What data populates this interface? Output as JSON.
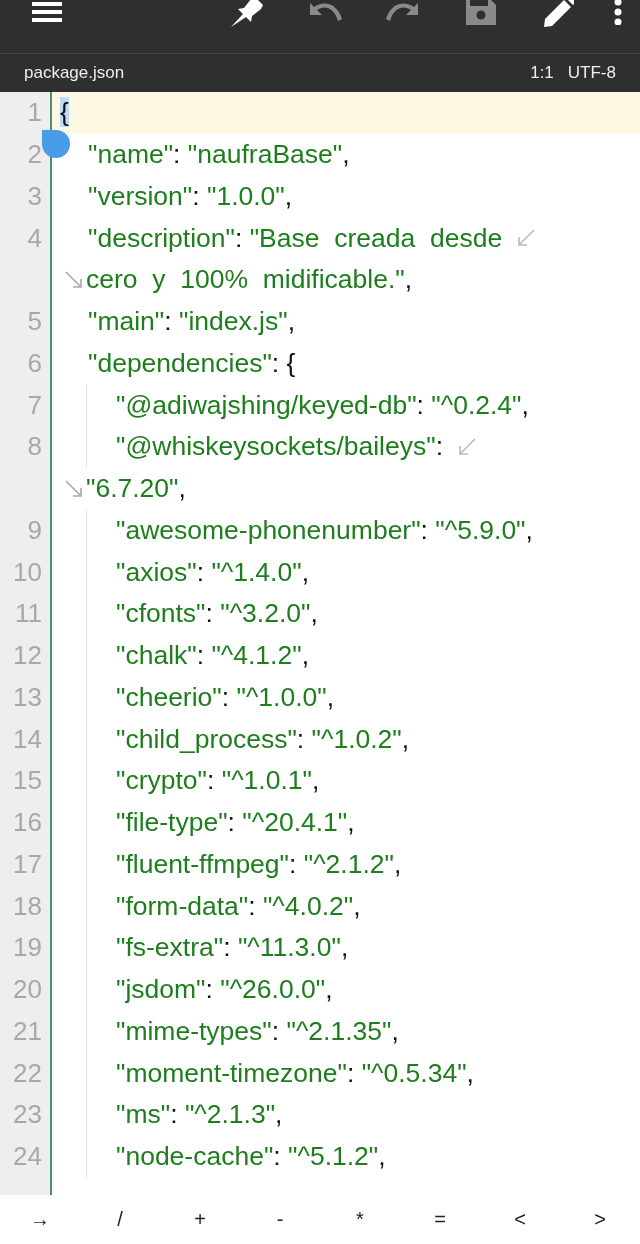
{
  "toolbar": [
    {
      "kind": "menu",
      "disabled": false
    },
    {
      "kind": "pin",
      "disabled": false
    },
    {
      "kind": "undo",
      "disabled": true
    },
    {
      "kind": "redo",
      "disabled": true
    },
    {
      "kind": "save",
      "disabled": true
    },
    {
      "kind": "edit",
      "disabled": false
    },
    {
      "kind": "more",
      "disabled": false
    }
  ],
  "file_bar": {
    "file_name": "package.json",
    "position": "1:1",
    "encoding": "UTF-8"
  },
  "editor": {
    "lines": [
      {
        "number": "1",
        "current": true,
        "rows": [
          {
            "tokens": [
              {
                "kind": "punct",
                "text": "{",
                "selected": true
              }
            ]
          }
        ],
        "children": [
          {
            "number": "2",
            "current": false,
            "rows": [
              {
                "tokens": [
                  {
                    "kind": "string",
                    "text": "\"name\""
                  },
                  {
                    "kind": "punct",
                    "text": ": "
                  },
                  {
                    "kind": "string",
                    "text": "\"naufraBase\""
                  },
                  {
                    "kind": "punct",
                    "text": ","
                  }
                ]
              }
            ]
          },
          {
            "number": "3",
            "current": false,
            "rows": [
              {
                "tokens": [
                  {
                    "kind": "string",
                    "text": "\"version\""
                  },
                  {
                    "kind": "punct",
                    "text": ": "
                  },
                  {
                    "kind": "string",
                    "text": "\"1.0.0\""
                  },
                  {
                    "kind": "punct",
                    "text": ","
                  }
                ]
              }
            ]
          },
          {
            "number": "4",
            "current": false,
            "rows": [
              {
                "tokens": [
                  {
                    "kind": "string",
                    "text": "\"description\""
                  },
                  {
                    "kind": "punct",
                    "text": ": "
                  },
                  {
                    "kind": "string",
                    "text": "\"Base  creada  desde"
                  }
                ]
              },
              {
                "tokens": [
                  {
                    "kind": "string",
                    "text": "cero  y  100%  midificable.\""
                  },
                  {
                    "kind": "punct",
                    "text": ","
                  }
                ]
              }
            ]
          },
          {
            "number": "5",
            "current": false,
            "rows": [
              {
                "tokens": [
                  {
                    "kind": "string",
                    "text": "\"main\""
                  },
                  {
                    "kind": "punct",
                    "text": ": "
                  },
                  {
                    "kind": "string",
                    "text": "\"index.js\""
                  },
                  {
                    "kind": "punct",
                    "text": ","
                  }
                ]
              }
            ]
          },
          {
            "number": "6",
            "current": false,
            "rows": [
              {
                "tokens": [
                  {
                    "kind": "string",
                    "text": "\"dependencies\""
                  },
                  {
                    "kind": "punct",
                    "text": ": {"
                  }
                ]
              }
            ],
            "children": [
              {
                "number": "7",
                "current": false,
                "rows": [
                  {
                    "tokens": [
                      {
                        "kind": "string",
                        "text": "\"@adiwajshing/keyed-db\""
                      },
                      {
                        "kind": "punct",
                        "text": ": "
                      },
                      {
                        "kind": "string",
                        "text": "\"^0.2.4\""
                      },
                      {
                        "kind": "punct",
                        "text": ","
                      }
                    ]
                  }
                ]
              },
              {
                "number": "8",
                "current": false,
                "rows": [
                  {
                    "tokens": [
                      {
                        "kind": "string",
                        "text": "\"@whiskeysockets/baileys\""
                      },
                      {
                        "kind": "punct",
                        "text": ":"
                      }
                    ]
                  },
                  {
                    "tokens": [
                      {
                        "kind": "string",
                        "text": "\"6.7.20\""
                      },
                      {
                        "kind": "punct",
                        "text": ","
                      }
                    ]
                  }
                ]
              },
              {
                "number": "9",
                "current": false,
                "rows": [
                  {
                    "tokens": [
                      {
                        "kind": "string",
                        "text": "\"awesome-phonenumber\""
                      },
                      {
                        "kind": "punct",
                        "text": ": "
                      },
                      {
                        "kind": "string",
                        "text": "\"^5.9.0\""
                      },
                      {
                        "kind": "punct",
                        "text": ","
                      }
                    ]
                  }
                ]
              },
              {
                "number": "10",
                "current": false,
                "rows": [
                  {
                    "tokens": [
                      {
                        "kind": "string",
                        "text": "\"axios\""
                      },
                      {
                        "kind": "punct",
                        "text": ": "
                      },
                      {
                        "kind": "string",
                        "text": "\"^1.4.0\""
                      },
                      {
                        "kind": "punct",
                        "text": ","
                      }
                    ]
                  }
                ]
              },
              {
                "number": "11",
                "current": false,
                "rows": [
                  {
                    "tokens": [
                      {
                        "kind": "string",
                        "text": "\"cfonts\""
                      },
                      {
                        "kind": "punct",
                        "text": ": "
                      },
                      {
                        "kind": "string",
                        "text": "\"^3.2.0\""
                      },
                      {
                        "kind": "punct",
                        "text": ","
                      }
                    ]
                  }
                ]
              },
              {
                "number": "12",
                "current": false,
                "rows": [
                  {
                    "tokens": [
                      {
                        "kind": "string",
                        "text": "\"chalk\""
                      },
                      {
                        "kind": "punct",
                        "text": ": "
                      },
                      {
                        "kind": "string",
                        "text": "\"^4.1.2\""
                      },
                      {
                        "kind": "punct",
                        "text": ","
                      }
                    ]
                  }
                ]
              },
              {
                "number": "13",
                "current": false,
                "rows": [
                  {
                    "tokens": [
                      {
                        "kind": "string",
                        "text": "\"cheerio\""
                      },
                      {
                        "kind": "punct",
                        "text": ": "
                      },
                      {
                        "kind": "string",
                        "text": "\"^1.0.0\""
                      },
                      {
                        "kind": "punct",
                        "text": ","
                      }
                    ]
                  }
                ]
              },
              {
                "number": "14",
                "current": false,
                "rows": [
                  {
                    "tokens": [
                      {
                        "kind": "string",
                        "text": "\"child_process\""
                      },
                      {
                        "kind": "punct",
                        "text": ": "
                      },
                      {
                        "kind": "string",
                        "text": "\"^1.0.2\""
                      },
                      {
                        "kind": "punct",
                        "text": ","
                      }
                    ]
                  }
                ]
              },
              {
                "number": "15",
                "current": false,
                "rows": [
                  {
                    "tokens": [
                      {
                        "kind": "string",
                        "text": "\"crypto\""
                      },
                      {
                        "kind": "punct",
                        "text": ": "
                      },
                      {
                        "kind": "string",
                        "text": "\"^1.0.1\""
                      },
                      {
                        "kind": "punct",
                        "text": ","
                      }
                    ]
                  }
                ]
              },
              {
                "number": "16",
                "current": false,
                "rows": [
                  {
                    "tokens": [
                      {
                        "kind": "string",
                        "text": "\"file-type\""
                      },
                      {
                        "kind": "punct",
                        "text": ": "
                      },
                      {
                        "kind": "string",
                        "text": "\"^20.4.1\""
                      },
                      {
                        "kind": "punct",
                        "text": ","
                      }
                    ]
                  }
                ]
              },
              {
                "number": "17",
                "current": false,
                "rows": [
                  {
                    "tokens": [
                      {
                        "kind": "string",
                        "text": "\"fluent-ffmpeg\""
                      },
                      {
                        "kind": "punct",
                        "text": ": "
                      },
                      {
                        "kind": "string",
                        "text": "\"^2.1.2\""
                      },
                      {
                        "kind": "punct",
                        "text": ","
                      }
                    ]
                  }
                ]
              },
              {
                "number": "18",
                "current": false,
                "rows": [
                  {
                    "tokens": [
                      {
                        "kind": "string",
                        "text": "\"form-data\""
                      },
                      {
                        "kind": "punct",
                        "text": ": "
                      },
                      {
                        "kind": "string",
                        "text": "\"^4.0.2\""
                      },
                      {
                        "kind": "punct",
                        "text": ","
                      }
                    ]
                  }
                ]
              },
              {
                "number": "19",
                "current": false,
                "rows": [
                  {
                    "tokens": [
                      {
                        "kind": "string",
                        "text": "\"fs-extra\""
                      },
                      {
                        "kind": "punct",
                        "text": ": "
                      },
                      {
                        "kind": "string",
                        "text": "\"^11.3.0\""
                      },
                      {
                        "kind": "punct",
                        "text": ","
                      }
                    ]
                  }
                ]
              },
              {
                "number": "20",
                "current": false,
                "rows": [
                  {
                    "tokens": [
                      {
                        "kind": "string",
                        "text": "\"jsdom\""
                      },
                      {
                        "kind": "punct",
                        "text": ": "
                      },
                      {
                        "kind": "string",
                        "text": "\"^26.0.0\""
                      },
                      {
                        "kind": "punct",
                        "text": ","
                      }
                    ]
                  }
                ]
              },
              {
                "number": "21",
                "current": false,
                "rows": [
                  {
                    "tokens": [
                      {
                        "kind": "string",
                        "text": "\"mime-types\""
                      },
                      {
                        "kind": "punct",
                        "text": ": "
                      },
                      {
                        "kind": "string",
                        "text": "\"^2.1.35\""
                      },
                      {
                        "kind": "punct",
                        "text": ","
                      }
                    ]
                  }
                ]
              },
              {
                "number": "22",
                "current": false,
                "rows": [
                  {
                    "tokens": [
                      {
                        "kind": "string",
                        "text": "\"moment-timezone\""
                      },
                      {
                        "kind": "punct",
                        "text": ": "
                      },
                      {
                        "kind": "string",
                        "text": "\"^0.5.34\""
                      },
                      {
                        "kind": "punct",
                        "text": ","
                      }
                    ]
                  }
                ]
              },
              {
                "number": "23",
                "current": false,
                "rows": [
                  {
                    "tokens": [
                      {
                        "kind": "string",
                        "text": "\"ms\""
                      },
                      {
                        "kind": "punct",
                        "text": ": "
                      },
                      {
                        "kind": "string",
                        "text": "\"^2.1.3\""
                      },
                      {
                        "kind": "punct",
                        "text": ","
                      }
                    ]
                  }
                ]
              },
              {
                "number": "24",
                "current": false,
                "rows": [
                  {
                    "tokens": [
                      {
                        "kind": "string",
                        "text": "\"node-cache\""
                      },
                      {
                        "kind": "punct",
                        "text": ": "
                      },
                      {
                        "kind": "string",
                        "text": "\"^5.1.2\""
                      },
                      {
                        "kind": "punct",
                        "text": ","
                      }
                    ]
                  }
                ]
              }
            ]
          }
        ]
      }
    ]
  },
  "keys": [
    "→",
    "/",
    "+",
    "-",
    "*",
    "=",
    "<",
    ">"
  ]
}
